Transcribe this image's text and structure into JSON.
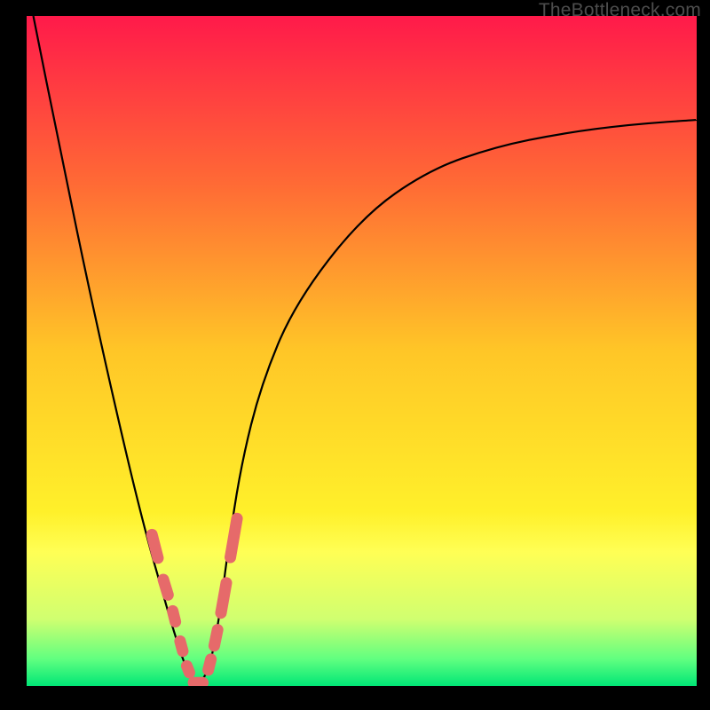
{
  "watermark": "TheBottleneck.com",
  "chart_data": {
    "type": "line",
    "title": "",
    "xlabel": "",
    "ylabel": "",
    "xlim": [
      0,
      100
    ],
    "ylim": [
      0,
      100
    ],
    "grid": false,
    "legend": false,
    "gradient_stops": [
      {
        "offset": 0,
        "color": "#ff1a4a"
      },
      {
        "offset": 25,
        "color": "#ff6a35"
      },
      {
        "offset": 50,
        "color": "#ffc627"
      },
      {
        "offset": 74,
        "color": "#fff02a"
      },
      {
        "offset": 80,
        "color": "#ffff55"
      },
      {
        "offset": 90,
        "color": "#d0ff70"
      },
      {
        "offset": 96,
        "color": "#60ff80"
      },
      {
        "offset": 100,
        "color": "#00e676"
      }
    ],
    "curve": {
      "description": "V-shaped bottleneck curve; y is mismatch percentage (high=red=bad, low=green=good)",
      "x": [
        1,
        5,
        10,
        15,
        18,
        20,
        22,
        24,
        25.5,
        27,
        28,
        29,
        30,
        32,
        35,
        40,
        50,
        60,
        70,
        80,
        90,
        100
      ],
      "y": [
        100,
        80,
        56,
        34,
        22,
        15,
        8,
        2,
        0,
        2,
        6,
        12,
        20,
        33,
        45,
        57,
        70,
        77,
        80.5,
        82.5,
        83.8,
        84.5
      ]
    },
    "markers": {
      "color": "#e66a6a",
      "description": "Pill-shaped segment markers along the lower portion of the curve near the minimum",
      "segments": [
        {
          "x1": 18.7,
          "y1": 22.6,
          "x2": 19.6,
          "y2": 19.1
        },
        {
          "x1": 20.4,
          "y1": 15.9,
          "x2": 21.1,
          "y2": 13.6
        },
        {
          "x1": 21.8,
          "y1": 11.2,
          "x2": 22.2,
          "y2": 9.6
        },
        {
          "x1": 22.9,
          "y1": 6.7,
          "x2": 23.3,
          "y2": 5.2
        },
        {
          "x1": 23.9,
          "y1": 3.0,
          "x2": 24.3,
          "y2": 2.0
        },
        {
          "x1": 24.9,
          "y1": 0.5,
          "x2": 26.3,
          "y2": 0.5
        },
        {
          "x1": 27.1,
          "y1": 2.4,
          "x2": 27.5,
          "y2": 4.0
        },
        {
          "x1": 28.0,
          "y1": 6.0,
          "x2": 28.5,
          "y2": 8.4
        },
        {
          "x1": 29.0,
          "y1": 10.9,
          "x2": 29.8,
          "y2": 15.4
        },
        {
          "x1": 30.4,
          "y1": 19.2,
          "x2": 31.4,
          "y2": 25.0
        }
      ]
    }
  }
}
